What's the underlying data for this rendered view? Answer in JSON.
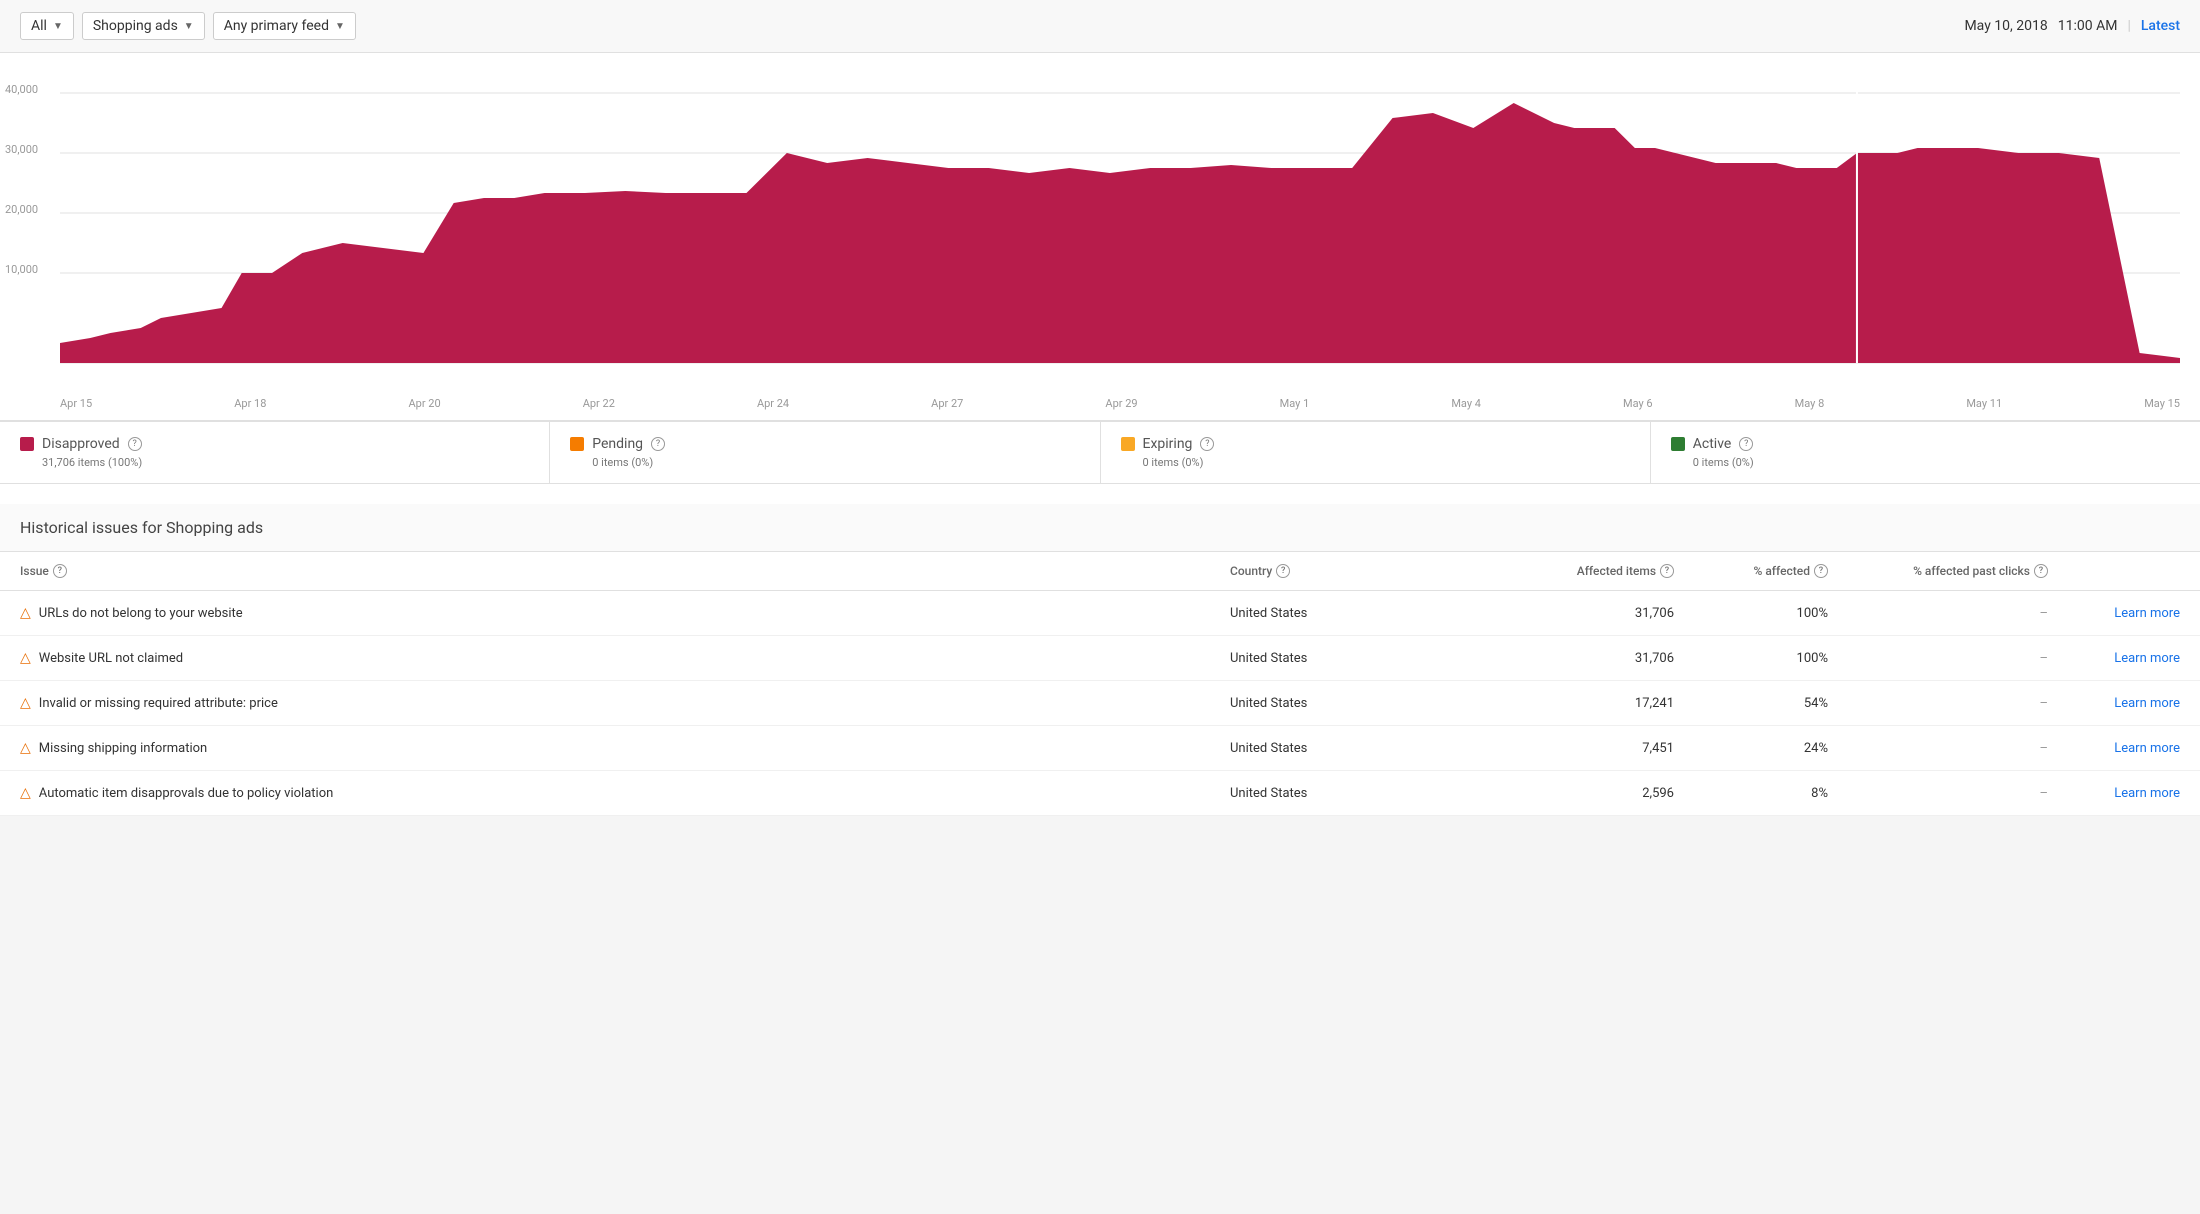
{
  "filterBar": {
    "allLabel": "All",
    "adTypeLabel": "Shopping ads",
    "feedLabel": "Any primary feed",
    "date": "May 10, 2018",
    "time": "11:00 AM",
    "separator": "|",
    "latestLabel": "Latest"
  },
  "chart": {
    "yAxisLabels": [
      "40,000",
      "30,000",
      "20,000",
      "10,000"
    ],
    "xAxisLabels": [
      "Apr 15",
      "Apr 18",
      "Apr 20",
      "Apr 22",
      "Apr 24",
      "Apr 27",
      "Apr 29",
      "May 1",
      "May 4",
      "May 6",
      "May 8",
      "May 11",
      "May 15"
    ],
    "color": "#b71c4b",
    "cursorLineColor": "#ffffff"
  },
  "legend": {
    "items": [
      {
        "label": "Disapproved",
        "color": "#b71c4b",
        "info": "31,706 items (100%)"
      },
      {
        "label": "Pending",
        "color": "#f57c00",
        "info": "0 items (0%)"
      },
      {
        "label": "Expiring",
        "color": "#f9a825",
        "info": "0 items (0%)"
      },
      {
        "label": "Active",
        "color": "#2e7d32",
        "info": "0 items (0%)"
      }
    ]
  },
  "issuesSection": {
    "title": "Historical issues for Shopping ads",
    "tableHeaders": {
      "issue": "Issue",
      "country": "Country",
      "affectedItems": "Affected items",
      "pctAffected": "% affected",
      "pctAffectedClicks": "% affected past clicks"
    },
    "rows": [
      {
        "issue": "URLs do not belong to your website",
        "country": "United States",
        "affectedItems": "31,706",
        "pctAffected": "100%",
        "pctClicks": "–",
        "learnMore": "Learn more"
      },
      {
        "issue": "Website URL not claimed",
        "country": "United States",
        "affectedItems": "31,706",
        "pctAffected": "100%",
        "pctClicks": "–",
        "learnMore": "Learn more"
      },
      {
        "issue": "Invalid or missing required attribute: price",
        "country": "United States",
        "affectedItems": "17,241",
        "pctAffected": "54%",
        "pctClicks": "–",
        "learnMore": "Learn more"
      },
      {
        "issue": "Missing shipping information",
        "country": "United States",
        "affectedItems": "7,451",
        "pctAffected": "24%",
        "pctClicks": "–",
        "learnMore": "Learn more"
      },
      {
        "issue": "Automatic item disapprovals due to policy violation",
        "country": "United States",
        "affectedItems": "2,596",
        "pctAffected": "8%",
        "pctClicks": "–",
        "learnMore": "Learn more"
      }
    ]
  }
}
